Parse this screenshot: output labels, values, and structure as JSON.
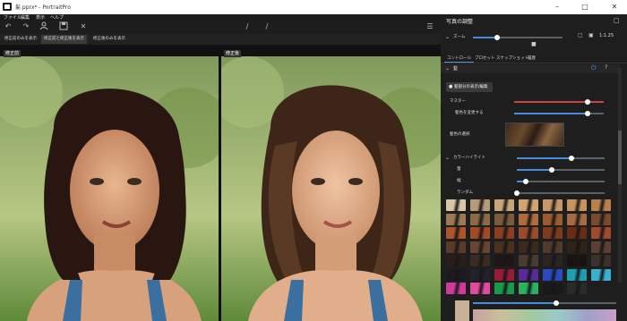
{
  "window": {
    "title": "髪.pprx* - PortraitPro"
  },
  "menu": [
    "ファイル",
    "編集",
    "表示",
    "ヘルプ"
  ],
  "view_tabs": [
    "修正前のみを表示",
    "修正前と修正後を表示",
    "修正後のみを表示"
  ],
  "labels": {
    "before": "修正前",
    "after": "修正後"
  },
  "panel": {
    "title": "写真の調整",
    "zoom_label": "ズーム",
    "zoom_value": "1:1.25",
    "tabs": [
      "コントロール",
      "プロセット",
      "スナップショット",
      "履歴"
    ],
    "section": "髪",
    "edit_button": "髪部分の表示/編集",
    "master": "マスター",
    "shine": "髪色を変更する",
    "color_select": "髪色の選択",
    "highlight": "カラーハイライト",
    "amount": "量",
    "size": "幅",
    "random": "ランダム",
    "levels": {
      "zoom": 0.27,
      "master": 0.82,
      "shine": 0.82,
      "highlight": 0.62,
      "amount": 0.4,
      "size": 0.1,
      "random": 0.0,
      "hue": 0.58
    }
  },
  "swatch_colors": [
    [
      "#d9c6a8",
      "#b79b78",
      "#c9a67a",
      "#d2a56e",
      "#c89768",
      "#c7945c",
      "#b97f4d"
    ],
    [
      "#9d7a55",
      "#8b6a48",
      "#7b5a3d",
      "#b06b3c",
      "#9a5b30",
      "#a66a45",
      "#7a4a2c"
    ],
    [
      "#b0542a",
      "#a24a26",
      "#8d3e1f",
      "#9b4a2a",
      "#7e3a1d",
      "#6b2c16",
      "#a04a2c"
    ],
    [
      "#5a3a28",
      "#6a4432",
      "#4a3020",
      "#3c2a1f",
      "#503a2c",
      "#2f2218",
      "#5c4031"
    ],
    [
      "#2a1e18",
      "#3a2a22",
      "#1f1714",
      "#4a3b30",
      "#2b2421",
      "#1a1410",
      "#3a312c"
    ],
    [
      "#1a1a22",
      "#22222c",
      "#9a1a3a",
      "#5a2a9a",
      "#2a4ac0",
      "#1aa0b0",
      "#3ab0d0"
    ],
    [
      "#d03a9a",
      "#e04aa0",
      "#1a9a4a",
      "#2ab060",
      "#1a1a1a",
      "#2a2a2a"
    ]
  ]
}
